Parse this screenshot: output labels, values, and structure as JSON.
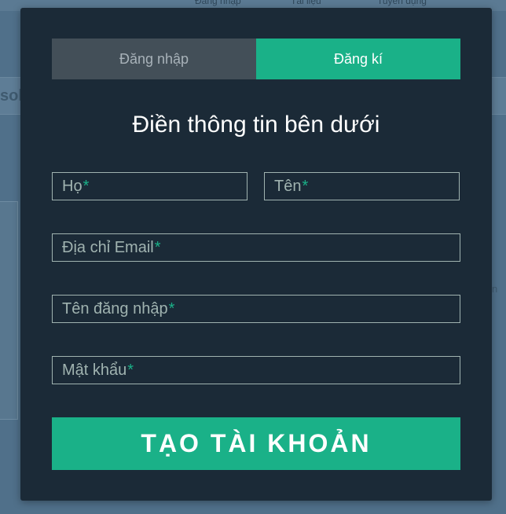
{
  "background": {
    "heading": "solidly Glosure",
    "topbar": [
      "Đăng nhập",
      "Tài liệu",
      "Tuyển dụng"
    ],
    "side_text": "n"
  },
  "tabs": [
    {
      "label": "Đăng nhập",
      "active": false
    },
    {
      "label": "Đăng kí",
      "active": true
    }
  ],
  "form": {
    "title": "Điền thông tin bên dưới",
    "required_mark": "*",
    "fields": {
      "ho": "Họ",
      "ten": "Tên",
      "email": "Địa chỉ Email",
      "username": "Tên đăng nhập",
      "password": "Mật khẩu"
    },
    "submit_label": "TẠO TÀI KHOẢN"
  },
  "colors": {
    "accent": "#1ab188",
    "modal_bg": "#1b2a37",
    "inactive_tab": "#434f58",
    "field_border": "#a0b3b0"
  }
}
